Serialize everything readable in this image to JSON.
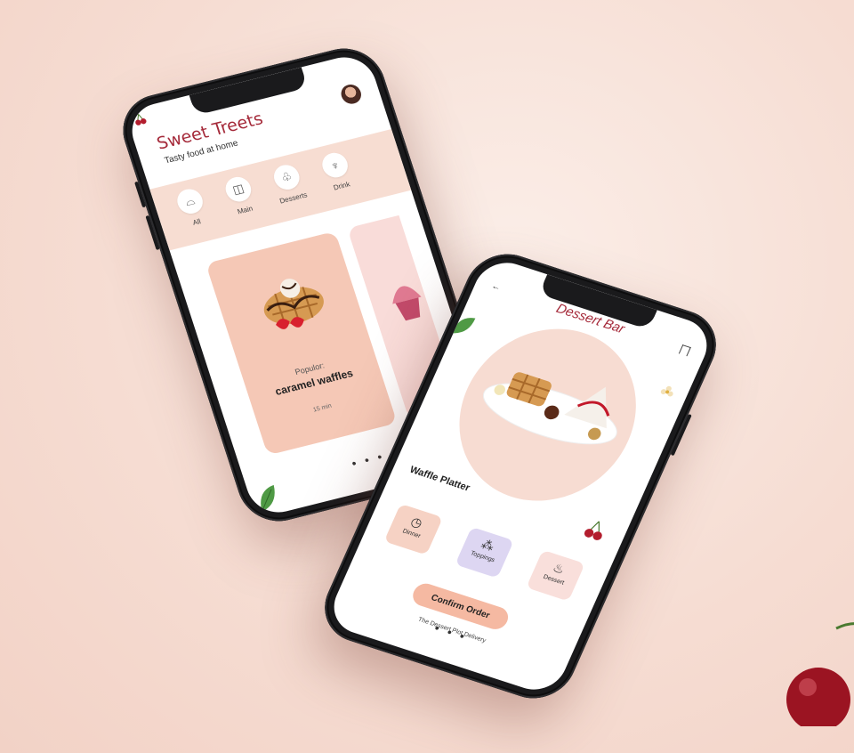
{
  "phone1": {
    "title": "Sweet Treets",
    "subtitle": "Tasty food at home",
    "categories": [
      {
        "label": "All",
        "icon": "cloche-icon"
      },
      {
        "label": "Main",
        "icon": "cake-slice-icon"
      },
      {
        "label": "Desserts",
        "icon": "cupcake-icon"
      },
      {
        "label": "Drink",
        "icon": "cocktail-icon"
      }
    ],
    "card": {
      "tag": "Populor:",
      "name": "caramel waffles",
      "time": "15 min"
    },
    "pager": "• • •"
  },
  "phone2": {
    "back": "←",
    "title": "Dessert Bar",
    "subtitle": "Waffle Platter",
    "options": [
      {
        "label": "Dinner",
        "icon": "clock-icon",
        "color": "#f6d2c4"
      },
      {
        "label": "Toppings",
        "icon": "sprinkles-icon",
        "color": "#ddd6f2"
      },
      {
        "label": "Dessert",
        "icon": "flame-icon",
        "color": "#f9dfdb"
      }
    ],
    "confirm_label": "Confirm Order",
    "footer": "The Dessert Plot Delivery",
    "pager": "• • •"
  },
  "colors": {
    "accent": "#a52a3a",
    "peach": "#f5c8b6",
    "background": "#f6ddd3"
  }
}
